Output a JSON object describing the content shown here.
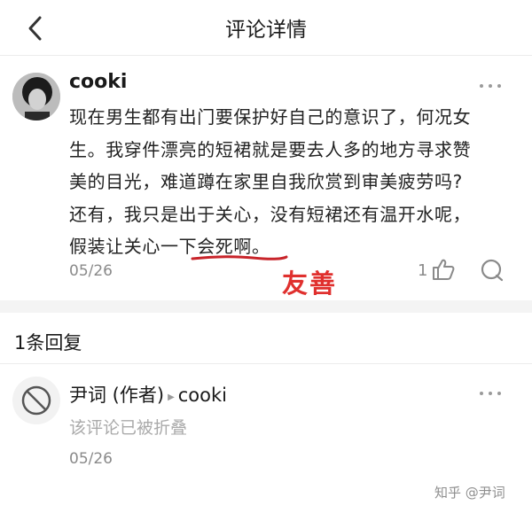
{
  "header": {
    "title": "评论详情"
  },
  "comment": {
    "author": "cooki",
    "lines": [
      "现在男生都有出门要保护好自己的意识了，何况女",
      "生。我穿件漂亮的短裙就是要去人多的地方寻求赞",
      "美的目光，难道蹲在家里自我欣赏到审美疲劳吗?",
      "还有，我只是出于关心，没有短裙还有温开水呢，",
      "假装让关心一下会死啊。"
    ],
    "date": "05/26",
    "like_count": "1"
  },
  "annotation": "友善",
  "replies": {
    "heading": "1条回复",
    "items": [
      {
        "author": "尹词 (作者)",
        "reply_to": "cooki",
        "content": "该评论已被折叠",
        "date": "05/26"
      }
    ]
  },
  "watermark": "知乎 @尹词",
  "icons": {
    "back": "chevron-left-icon",
    "more": "more-dots-icon",
    "like": "thumbs-up-icon",
    "reply": "comment-bubble-icon",
    "avatar_blocked": "prohibited-icon"
  }
}
